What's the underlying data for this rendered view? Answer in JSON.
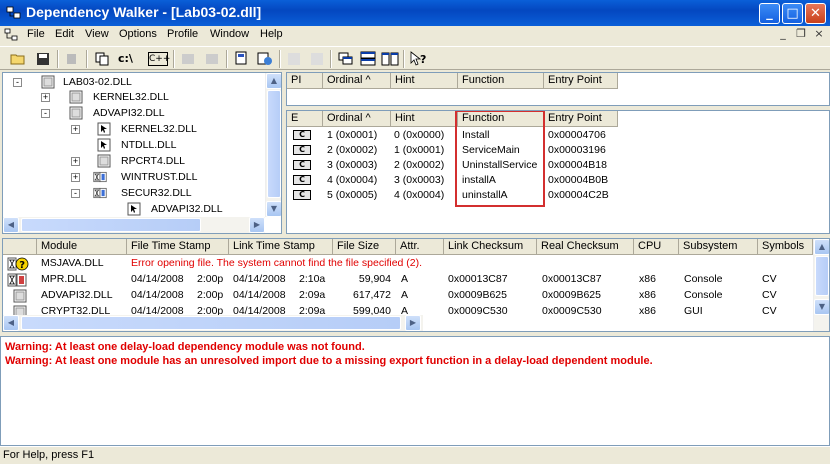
{
  "window": {
    "title": "Dependency Walker - [Lab03-02.dll]",
    "minimize": "_",
    "maximize": "□",
    "close": "✕"
  },
  "menu": {
    "items": [
      "File",
      "Edit",
      "View",
      "Options",
      "Profile",
      "Window",
      "Help"
    ],
    "mdi_min": "_",
    "mdi_restore": "❐",
    "mdi_close": "×"
  },
  "toolbar": {
    "buttons": [
      "open-icon",
      "save-icon",
      "refresh-icon",
      "copy-icon",
      "full-paths-icon",
      "undecorate-cpp-icon",
      "highlight-matching-icon",
      "find-icon",
      "properties-icon",
      "system-info-icon",
      "expand-icon",
      "collapse-icon",
      "cascade-icon",
      "tile-horizontal-icon",
      "tile-vertical-icon",
      "context-help-icon"
    ],
    "paths_label": "c:\\",
    "cpp_label": "C++"
  },
  "tree": {
    "nodes": [
      {
        "label": "LAB03-02.DLL",
        "depth": 0,
        "expander": "-"
      },
      {
        "label": "KERNEL32.DLL",
        "depth": 1,
        "expander": "+"
      },
      {
        "label": "ADVAPI32.DLL",
        "depth": 1,
        "expander": "-"
      },
      {
        "label": "KERNEL32.DLL",
        "depth": 2,
        "expander": "+"
      },
      {
        "label": "NTDLL.DLL",
        "depth": 2,
        "expander": ""
      },
      {
        "label": "RPCRT4.DLL",
        "depth": 2,
        "expander": "+"
      },
      {
        "label": "WINTRUST.DLL",
        "depth": 2,
        "expander": "+"
      },
      {
        "label": "SECUR32.DLL",
        "depth": 2,
        "expander": "-"
      },
      {
        "label": "ADVAPI32.DLL",
        "depth": 3,
        "expander": ""
      }
    ]
  },
  "imports": {
    "headers": [
      "PI",
      "Ordinal ^",
      "Hint",
      "Function",
      "Entry Point"
    ]
  },
  "exports": {
    "headers": [
      "E",
      "Ordinal ^",
      "Hint",
      "Function",
      "Entry Point"
    ],
    "icon_label": "C",
    "rows": [
      {
        "ordinal": "1 (0x0001)",
        "hint": "0 (0x0000)",
        "function": "Install",
        "entry": "0x00004706"
      },
      {
        "ordinal": "2 (0x0002)",
        "hint": "1 (0x0001)",
        "function": "ServiceMain",
        "entry": "0x00003196"
      },
      {
        "ordinal": "3 (0x0003)",
        "hint": "2 (0x0002)",
        "function": "UninstallService",
        "entry": "0x00004B18"
      },
      {
        "ordinal": "4 (0x0004)",
        "hint": "3 (0x0003)",
        "function": "installA",
        "entry": "0x00004B0B"
      },
      {
        "ordinal": "5 (0x0005)",
        "hint": "4 (0x0004)",
        "function": "uninstallA",
        "entry": "0x00004C2B"
      }
    ]
  },
  "modules": {
    "headers": [
      "",
      "Module",
      "File Time Stamp",
      "Link Time Stamp",
      "File Size",
      "Attr.",
      "Link Checksum",
      "Real Checksum",
      "CPU",
      "Subsystem",
      "Symbols"
    ],
    "rows": [
      {
        "module": "MSJAVA.DLL",
        "error": "Error opening file. The system cannot find the file specified (2)."
      },
      {
        "module": "MPR.DLL",
        "file_date": "04/14/2008",
        "file_time": "2:00p",
        "link_date": "04/14/2008",
        "link_time": "2:10a",
        "size": "59,904",
        "attr": "A",
        "link_checksum": "0x00013C87",
        "real_checksum": "0x00013C87",
        "cpu": "x86",
        "subsystem": "Console",
        "symbols": "CV"
      },
      {
        "module": "ADVAPI32.DLL",
        "file_date": "04/14/2008",
        "file_time": "2:00p",
        "link_date": "04/14/2008",
        "link_time": "2:09a",
        "size": "617,472",
        "attr": "A",
        "link_checksum": "0x0009B625",
        "real_checksum": "0x0009B625",
        "cpu": "x86",
        "subsystem": "Console",
        "symbols": "CV"
      },
      {
        "module": "CRYPT32.DLL",
        "file_date": "04/14/2008",
        "file_time": "2:00p",
        "link_date": "04/14/2008",
        "link_time": "2:09a",
        "size": "599,040",
        "attr": "A",
        "link_checksum": "0x0009C530",
        "real_checksum": "0x0009C530",
        "cpu": "x86",
        "subsystem": "GUI",
        "symbols": "CV"
      }
    ]
  },
  "log": {
    "lines": [
      "Warning: At least one delay-load dependency module was not found.",
      "Warning: At least one module has an unresolved import due to a missing export function in a delay-load dependent module."
    ]
  },
  "status": {
    "text": "For Help, press F1"
  },
  "colors": {
    "title_blue": "#0a5fd8",
    "warning_red": "#e00000",
    "highlight_box": "#d32f2f"
  }
}
